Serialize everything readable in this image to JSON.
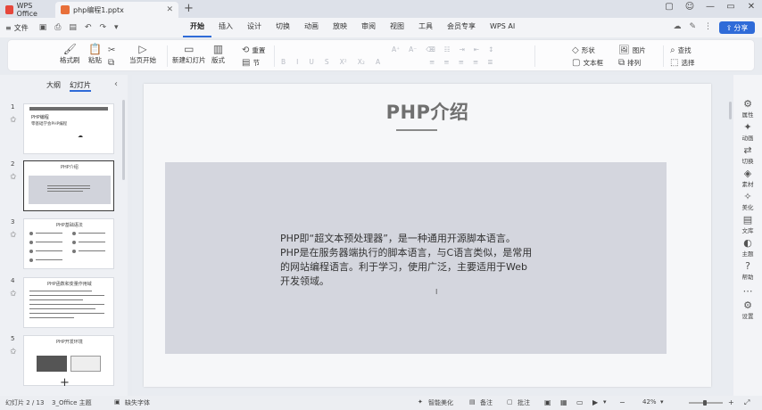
{
  "titlebar": {
    "tabs": [
      {
        "label": "WPS Office",
        "icon": "wps-logo-icon"
      },
      {
        "label": "php编程1.pptx",
        "icon": "ppt-file-icon"
      }
    ],
    "add_tab": "+",
    "win_buttons": [
      "▢",
      "☺",
      "—",
      "▭",
      "✕"
    ]
  },
  "menubar": {
    "file_label": "文件",
    "menus": [
      "开始",
      "插入",
      "设计",
      "切换",
      "动画",
      "放映",
      "审阅",
      "视图",
      "工具",
      "会员专享",
      "WPS AI"
    ],
    "active": "开始",
    "share_label": "分享"
  },
  "ribbon": {
    "format_painter": "格式刷",
    "paste": "粘贴",
    "current_start": "当页开始",
    "new_slide": "新建幻灯片",
    "layout": "版式",
    "section": "节",
    "reset": "重置",
    "shape": "形状",
    "picture": "图片",
    "textbox": "文本框",
    "arrange": "排列",
    "find": "查找",
    "select": "选择"
  },
  "leftpanel": {
    "tabs": [
      "大纲",
      "幻灯片"
    ],
    "active_tab": "幻灯片",
    "slide_numbers": [
      "1",
      "2",
      "3",
      "4",
      "5"
    ],
    "thumb1": {
      "title": "PHP编程",
      "subtitle": "零基础学会PHP编程"
    },
    "thumb2": {
      "title": "PHP介绍"
    },
    "thumb3": {
      "title": "PHP基础语法"
    },
    "thumb4": {
      "title": "PHP函数和变量作用域"
    },
    "thumb5": {
      "title": "PHP开发环境"
    },
    "add_slide": "+"
  },
  "slide": {
    "title": "PHP介绍",
    "paragraphs": [
      "PHP即“超文本预处理器”，是一种通用开源脚本语言。",
      "PHP是在服务器端执行的脚本语言，与C语言类似，是常用",
      "的网站编程语言。利于学习，使用广泛，主要适用于Web",
      "开发领域。"
    ]
  },
  "rightbar": {
    "items": [
      "属性",
      "动画",
      "切换",
      "素材",
      "美化",
      "文库",
      "主题",
      "帮助",
      "设置"
    ]
  },
  "statusbar": {
    "slide_pos": "幻灯片 2 / 13",
    "theme": "3_Office 主题",
    "font_missing": "缺失字体",
    "smart_beautify": "智能美化",
    "notes": "备注",
    "comments": "批注",
    "zoom": "42%"
  }
}
